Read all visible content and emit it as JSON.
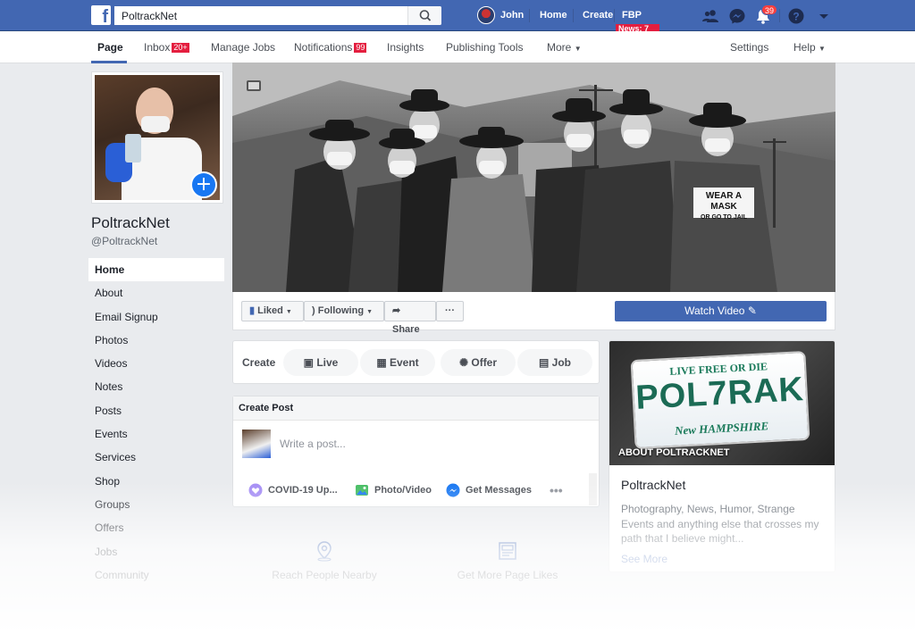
{
  "topbar": {
    "search_value": "PoltrackNet",
    "user_name": "John",
    "home_label": "Home",
    "create_label": "Create",
    "fbp_label": "FBP",
    "news_badge": "News: 7",
    "notification_count": "39",
    "accent_color": "#4267b2"
  },
  "tabs": {
    "page": "Page",
    "inbox": "Inbox",
    "inbox_badge": "20+",
    "manage_jobs": "Manage Jobs",
    "notifications": "Notifications",
    "notifications_badge": "99",
    "insights": "Insights",
    "publishing_tools": "Publishing Tools",
    "more": "More",
    "settings": "Settings",
    "help": "Help"
  },
  "profile": {
    "name": "PoltrackNet",
    "handle": "@PoltrackNet"
  },
  "leftnav": [
    {
      "label": "Home"
    },
    {
      "label": "About"
    },
    {
      "label": "Email Signup"
    },
    {
      "label": "Photos"
    },
    {
      "label": "Videos"
    },
    {
      "label": "Notes"
    },
    {
      "label": "Posts"
    },
    {
      "label": "Events"
    },
    {
      "label": "Services"
    },
    {
      "label": "Shop"
    },
    {
      "label": "Groups"
    },
    {
      "label": "Offers"
    },
    {
      "label": "Jobs"
    },
    {
      "label": "Community"
    }
  ],
  "cover": {
    "sign_line1": "WEAR A MASK",
    "sign_line2": "OR GO TO JAIL"
  },
  "actions": {
    "liked": "Liked",
    "following": "Following",
    "share": "Share",
    "watch_video": "Watch Video"
  },
  "create": {
    "label": "Create",
    "live": "Live",
    "event": "Event",
    "offer": "Offer",
    "job": "Job"
  },
  "post": {
    "header": "Create Post",
    "placeholder": "Write a post...",
    "covid": "COVID-19 Up...",
    "photo_video": "Photo/Video",
    "get_messages": "Get Messages"
  },
  "about": {
    "plate_top": "LIVE FREE OR DIE",
    "plate_number": "POL7RAK",
    "plate_state": "New HAMPSHIRE",
    "overlay": "ABOUT POLTRACKNET",
    "title": "PoltrackNet",
    "description": "Photography, News, Humor, Strange Events and anything else that crosses my path that I believe might...",
    "see_more": "See More"
  },
  "promos": {
    "nearby": "Reach People Nearby",
    "likes": "Get More Page Likes"
  }
}
